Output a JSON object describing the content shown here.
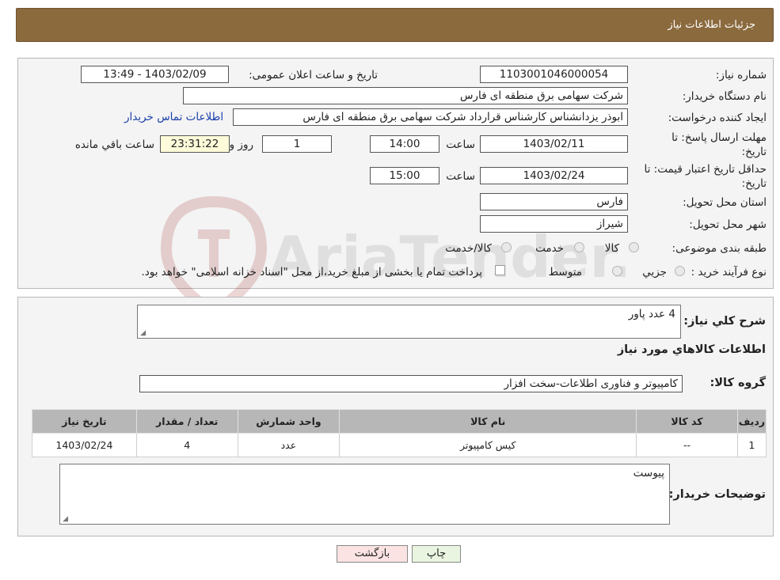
{
  "header": {
    "title": "جزئیات اطلاعات نیاز"
  },
  "form": {
    "need_number_label": "شماره نیاز:",
    "need_number": "1103001046000054",
    "announce_label": "تاریخ و ساعت اعلان عمومی:",
    "announce_value": "1403/02/09 - 13:49",
    "buyer_org_label": "نام دستگاه خریدار:",
    "buyer_org": "شرکت سهامی برق منطقه ای فارس",
    "creator_label": "ایجاد کننده درخواست:",
    "creator": "ابوذر  یزدانشناس کارشناس قرارداد شرکت سهامی برق منطقه ای فارس",
    "contact_link": "اطلاعات تماس خریدار",
    "deadline_label_1": "مهلت ارسال پاسخ: تا",
    "deadline_label_2": "تاریخ:",
    "deadline_date": "1403/02/11",
    "time_label": "ساعت",
    "deadline_time": "14:00",
    "days_value": "1",
    "days_label": "روز و",
    "remaining_time": "23:31:22",
    "remaining_label": "ساعت باقي مانده",
    "validity_label_1": "حداقل تاریخ اعتبار قیمت: تا",
    "validity_label_2": "تاریخ:",
    "validity_date": "1403/02/24",
    "validity_time": "15:00",
    "province_label": "استان محل تحویل:",
    "province": "فارس",
    "city_label": "شهر محل تحویل:",
    "city": "شیراز",
    "category_label": "طبقه بندی موضوعی:",
    "category_options": [
      "کالا",
      "خدمت",
      "کالا/خدمت"
    ],
    "process_label": "نوع فرآیند خرید :",
    "process_options": [
      "جزیي",
      "متوسط"
    ],
    "payment_note": "پرداخت تمام یا بخشی از مبلغ خرید،از محل \"اسناد خزانه اسلامی\" خواهد بود."
  },
  "details": {
    "summary_label": "شرح کلي نياز:",
    "summary": "4 عدد پاور",
    "items_heading": "اطلاعات کالاهاي مورد نياز",
    "group_label": "گروه کالا:",
    "group": "کامپیوتر و فناوری اطلاعات-سخت افزار",
    "table": {
      "headers": [
        "رديف",
        "کد کالا",
        "نام کالا",
        "واحد شمارش",
        "تعداد / مقدار",
        "تاریخ نیاز"
      ],
      "rows": [
        [
          "1",
          "--",
          "کیس کامپیوتر",
          "عدد",
          "4",
          "1403/02/24"
        ]
      ]
    },
    "buyer_notes_label": "توضیحات خریدار:",
    "buyer_notes": "پیوست"
  },
  "buttons": {
    "print": "چاپ",
    "back": "بازگشت"
  },
  "watermark": {
    "text": "AriaTender.neT"
  },
  "colors": {
    "header_bg": "#8b6a3e",
    "link": "#1a3faa",
    "table_header": "#b7b7b7"
  }
}
